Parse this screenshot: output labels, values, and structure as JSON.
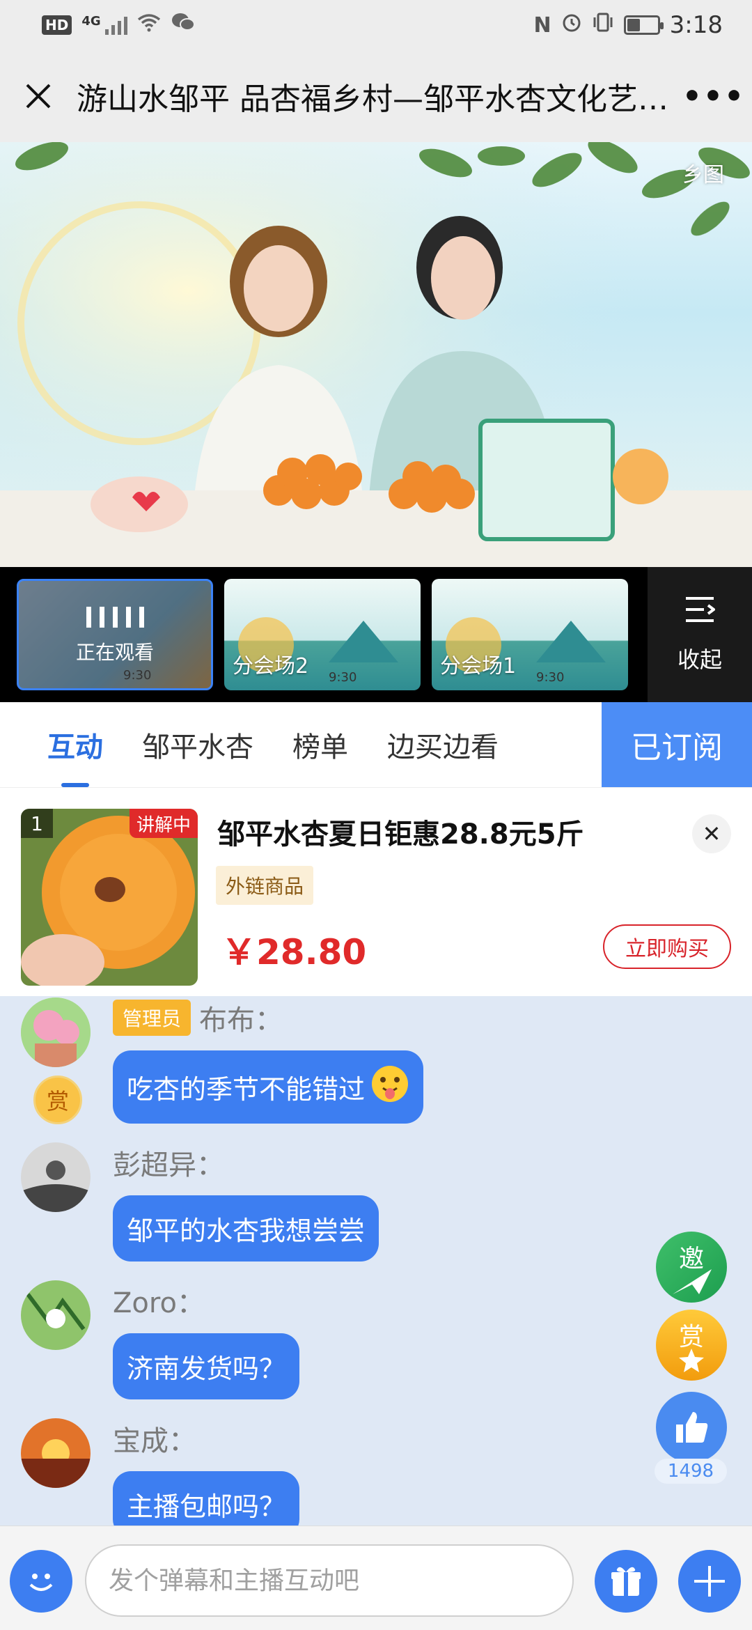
{
  "status_bar": {
    "hd": "HD",
    "network": "4G",
    "time": "3:18"
  },
  "nav": {
    "title": "游山水邹平 品杏福乡村—邹平水杏文化艺…",
    "more": "•••"
  },
  "video": {
    "watermark": "乡图"
  },
  "sessions": {
    "items": [
      {
        "label": "正在观看",
        "time": "9:30",
        "active": true
      },
      {
        "label": "分会场2",
        "time": "9:30",
        "active": false
      },
      {
        "label": "分会场1",
        "time": "9:30",
        "active": false
      }
    ],
    "collapse_label": "收起"
  },
  "tabs": {
    "items": [
      {
        "label": "互动",
        "active": true
      },
      {
        "label": "邹平水杏"
      },
      {
        "label": "榜单"
      },
      {
        "label": "边买边看"
      }
    ],
    "subscribed_label": "已订阅"
  },
  "product": {
    "rank": "1",
    "live_badge": "讲解中",
    "title": "邹平水杏夏日钜惠28.8元5斤",
    "tag": "外链商品",
    "price": "￥28.80",
    "buy_label": "立即购买"
  },
  "chat": {
    "messages": [
      {
        "badge": "管理员",
        "name": "布布：",
        "text": "吃杏的季节不能错过",
        "reward": "赏"
      },
      {
        "name": "彭超异：",
        "text": "邹平的水杏我想尝尝"
      },
      {
        "name": "Zoro：",
        "text": "济南发货吗？"
      },
      {
        "name": "宝成：",
        "text": "主播包邮吗？"
      }
    ]
  },
  "floating": {
    "invite": "邀",
    "reward": "赏",
    "like_count": "1498"
  },
  "input": {
    "placeholder": "发个弹幕和主播互动吧"
  },
  "colors": {
    "primary": "#3d7ef1",
    "price_red": "#e02a2a",
    "admin": "#f7b52e"
  }
}
